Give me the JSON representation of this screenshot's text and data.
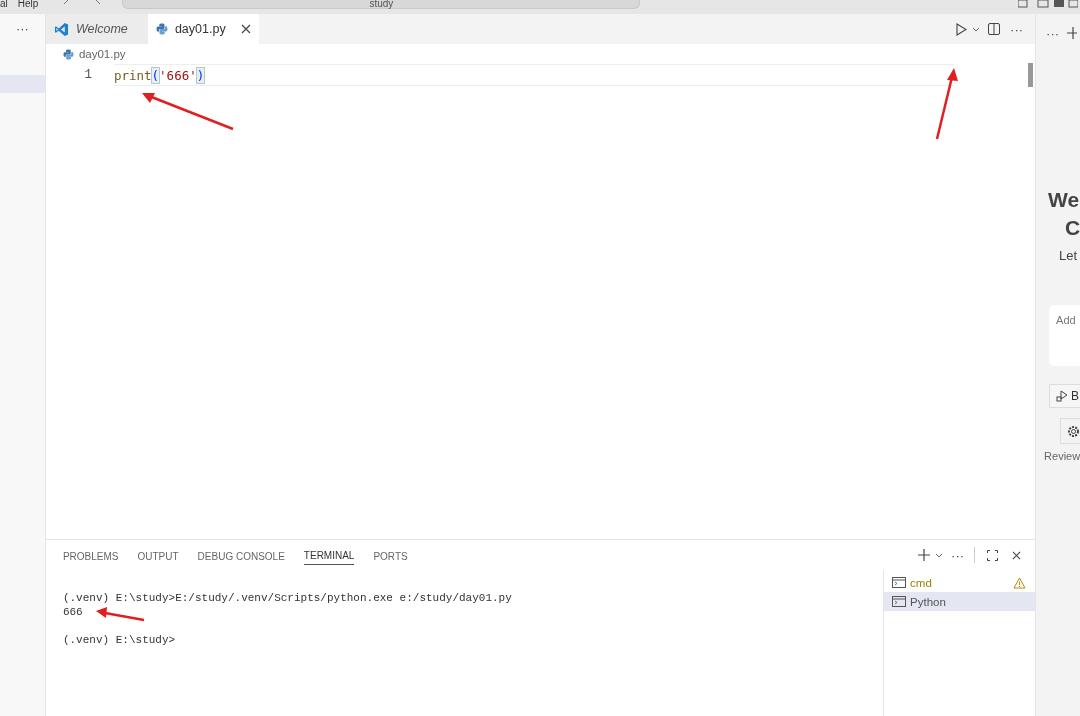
{
  "menubar": {
    "items": [
      "al",
      "Help"
    ],
    "search": "study"
  },
  "sidebar": {
    "more": "···"
  },
  "tabs": [
    {
      "label": "Welcome",
      "kind": "welcome",
      "selected": false
    },
    {
      "label": "day01.py",
      "kind": "python",
      "selected": true
    }
  ],
  "editor_actions": {
    "more": "···"
  },
  "breadcrumb": "day01.py",
  "code": [
    {
      "number": "1",
      "tokens": [
        {
          "text": "print",
          "kind": "function"
        },
        {
          "text": "(",
          "kind": "bracket"
        },
        {
          "text": "'666'",
          "kind": "string"
        },
        {
          "text": ")",
          "kind": "bracket"
        }
      ]
    }
  ],
  "panel_tabs": [
    {
      "label": "PROBLEMS",
      "selected": false
    },
    {
      "label": "OUTPUT",
      "selected": false
    },
    {
      "label": "DEBUG CONSOLE",
      "selected": false
    },
    {
      "label": "TERMINAL",
      "selected": true
    },
    {
      "label": "PORTS",
      "selected": false
    }
  ],
  "panel_actions": {
    "more": "···"
  },
  "terminal_blocks": [
    [
      "(.venv) E:\\study>E:/study/.venv/Scripts/python.exe e:/study/day01.py",
      "666"
    ],
    [
      "(.venv) E:\\study>"
    ]
  ],
  "terminals": [
    {
      "name": "cmd",
      "warning": true,
      "selected": false
    },
    {
      "name": "Python",
      "warning": false,
      "selected": true
    }
  ],
  "right_panel": {
    "more": "···",
    "title_lines": [
      "We",
      "C"
    ],
    "text": "Let",
    "placeholder": "Add",
    "button": "B",
    "footer": "Review"
  }
}
